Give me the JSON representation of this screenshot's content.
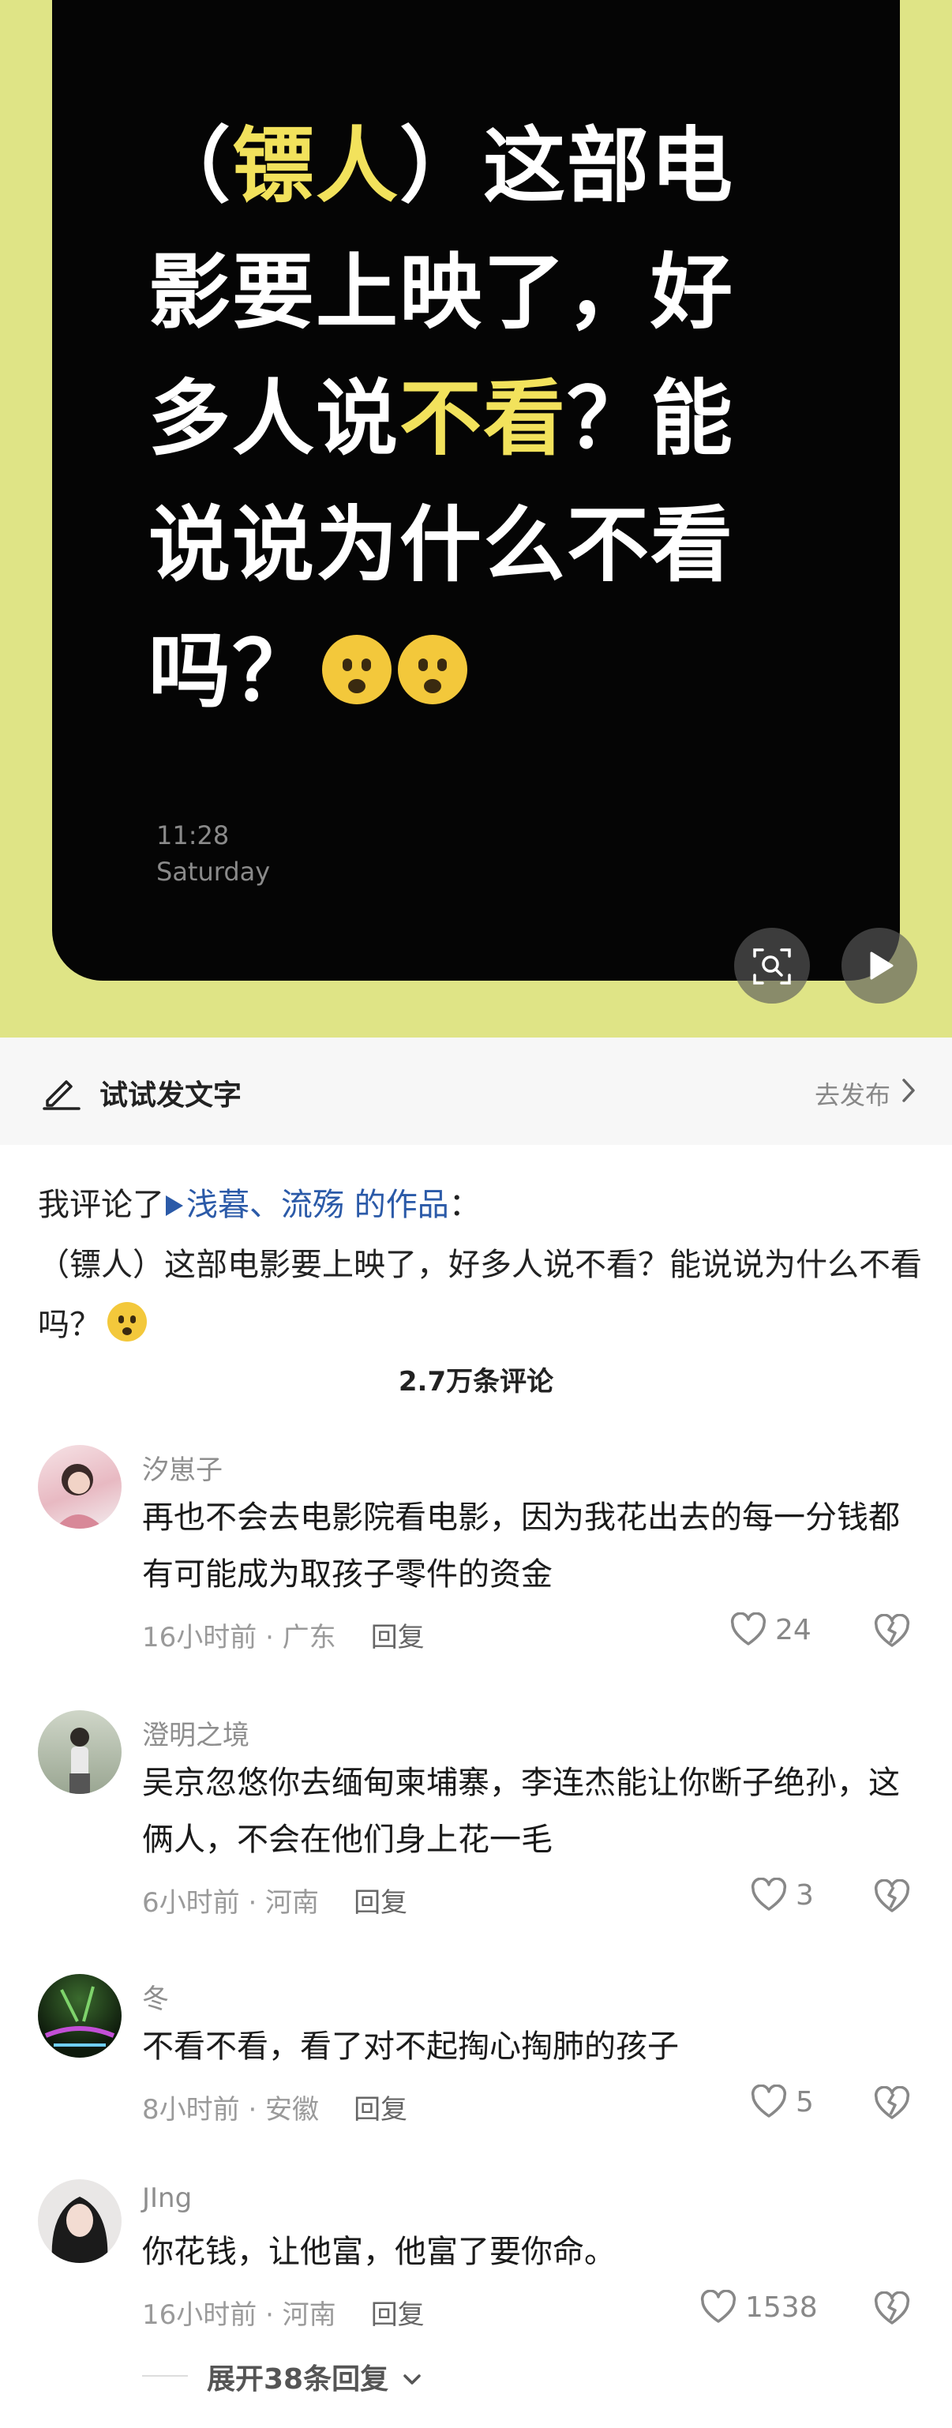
{
  "hero": {
    "title_line1_open": "（",
    "title_line1_hl": "镖人",
    "title_line1_rest": "）这部电",
    "title_line2": "影要上映了，好",
    "title_line3_pre": "多人说",
    "title_line3_hl": "不看",
    "title_line3_post": "？能",
    "title_line4": "说说为什么不看",
    "title_line5": "吗？",
    "time": "11:28",
    "day": "Saturday",
    "accent_color": "#f2e25c",
    "bg_color": "#dfe486",
    "icons": [
      "emoji-fearful-icon",
      "image-search-icon",
      "play-icon"
    ]
  },
  "postbar": {
    "label": "试试发文字",
    "action": "去发布"
  },
  "note": {
    "prefix": "我评论了",
    "authors": "浅暮、流殇 的作品",
    "suffix": "：",
    "text": "（镖人）这部电影要上映了，好多人说不看？能说说为什么不看吗？"
  },
  "comment_count": "2.7万条评论",
  "comments": [
    {
      "name": "汐崽子",
      "text": "再也不会去电影院看电影，因为我花出去的每一分钱都有可能成为取孩子零件的资金",
      "time": "16小时前 · 广东",
      "reply": "回复",
      "likes": "24"
    },
    {
      "name": "澄明之境",
      "text": "吴京忽悠你去缅甸柬埔寨，李连杰能让你断子绝孙，这俩人，不会在他们身上花一毛",
      "time": "6小时前 · 河南",
      "reply": "回复",
      "likes": "3"
    },
    {
      "name": "冬",
      "text": "不看不看，看了对不起掏心掏肺的孩子",
      "time": "8小时前 · 安徽",
      "reply": "回复",
      "likes": "5"
    },
    {
      "name": "JIng",
      "text": "你花钱，让他富，他富了要你命。",
      "time": "16小时前 · 河南",
      "reply": "回复",
      "likes": "1538"
    }
  ],
  "expand": "展开38条回复"
}
